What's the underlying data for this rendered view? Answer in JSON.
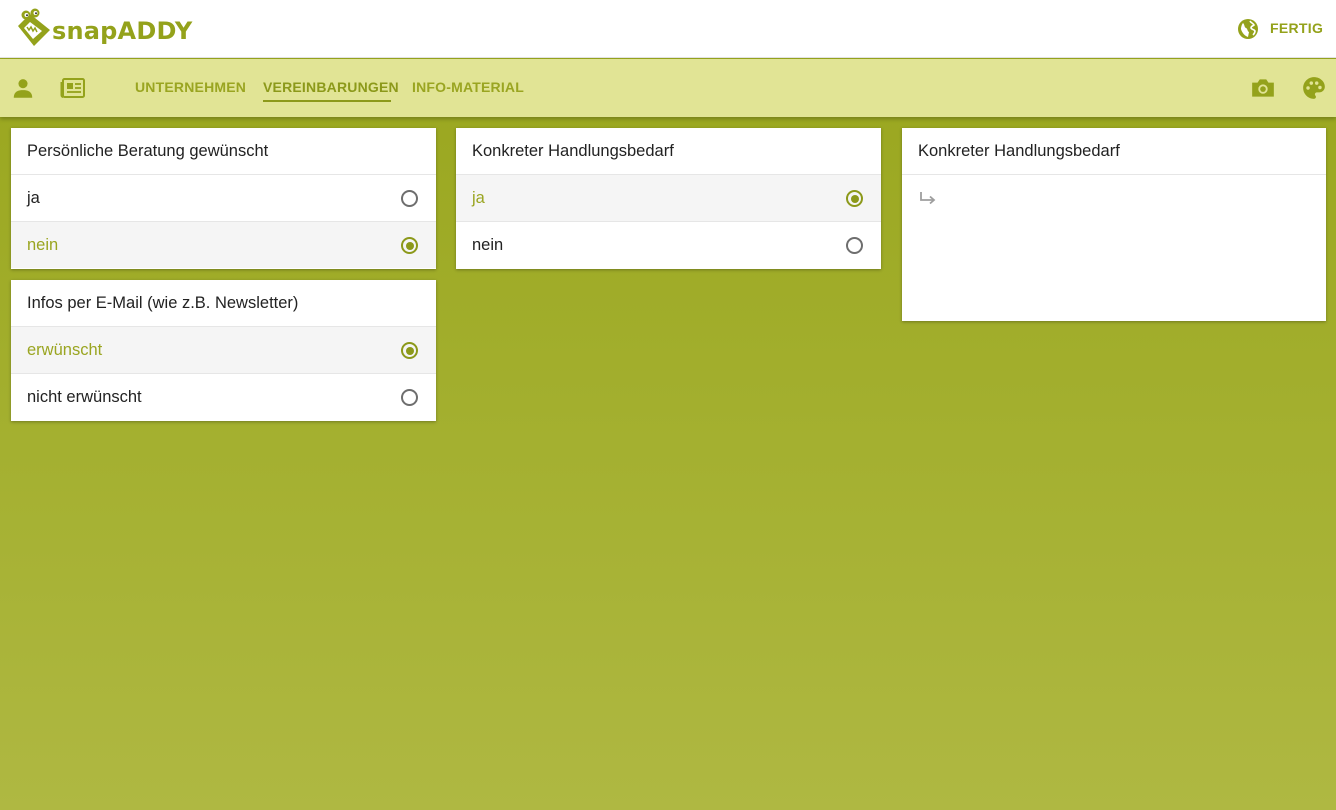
{
  "app": {
    "name": "snapADDY",
    "done_label": "FERTIG",
    "brand_color": "#94a21b",
    "toolbar_color": "#e1e495"
  },
  "toolbar": {
    "icons": [
      "person-icon",
      "newspaper-icon",
      "camera-icon",
      "palette-icon"
    ],
    "tabs": [
      {
        "label": "UNTERNEHMEN",
        "active": false
      },
      {
        "label": "VEREINBARUNGEN",
        "active": true
      },
      {
        "label": "INFO-MATERIAL",
        "active": false
      }
    ]
  },
  "cards": [
    {
      "title": "Persönliche Beratung gewünscht",
      "options": [
        {
          "label": "ja",
          "selected": false
        },
        {
          "label": "nein",
          "selected": true
        }
      ]
    },
    {
      "title": "Infos per E-Mail (wie z.B. Newsletter)",
      "options": [
        {
          "label": "erwünscht",
          "selected": true
        },
        {
          "label": "nicht erwünscht",
          "selected": false
        }
      ]
    },
    {
      "title": "Konkreter Handlungsbedarf",
      "options": [
        {
          "label": "ja",
          "selected": true
        },
        {
          "label": "nein",
          "selected": false
        }
      ]
    },
    {
      "title": "Konkreter Handlungsbedarf",
      "icon": "subdirectory-arrow-icon"
    }
  ]
}
